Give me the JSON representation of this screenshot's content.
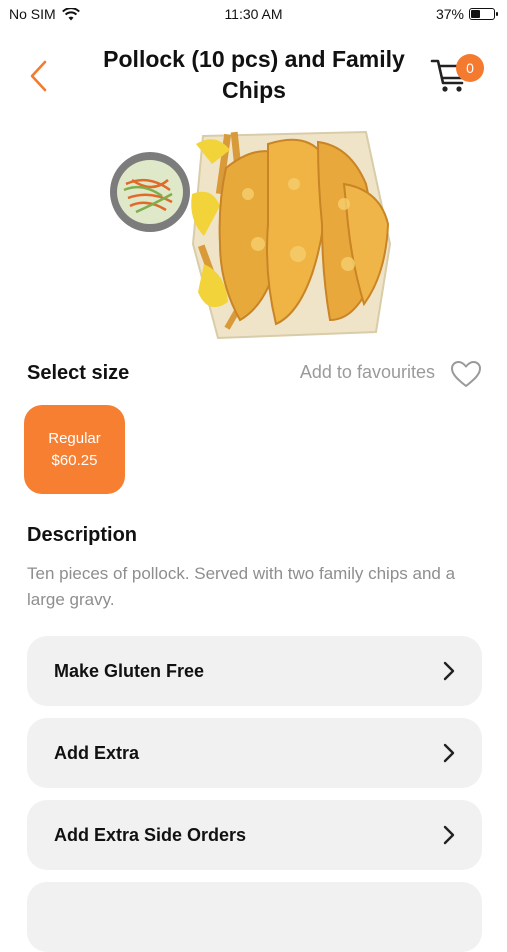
{
  "status_bar": {
    "carrier": "No SIM",
    "time": "11:30 AM",
    "battery": "37%",
    "battery_level": 0.37
  },
  "header": {
    "title": "Pollock (10 pcs) and Family Chips",
    "cart_count": "0"
  },
  "size_section": {
    "heading": "Select size",
    "favourites_label": "Add to favourites",
    "options": [
      {
        "name": "Regular",
        "price": "$60.25",
        "selected": true
      }
    ]
  },
  "description": {
    "heading": "Description",
    "text": "Ten pieces of pollock. Served with two family chips and a large gravy."
  },
  "options_list": [
    {
      "label": "Make Gluten Free"
    },
    {
      "label": "Add Extra"
    },
    {
      "label": "Add Extra Side Orders"
    },
    {
      "label": ""
    }
  ],
  "colors": {
    "accent": "#f77f32",
    "card_bg": "#f1f1f1",
    "muted_text": "#8e8e8e"
  },
  "icons": [
    "back-chevron-icon",
    "cart-icon",
    "heart-icon",
    "chevron-right-icon",
    "wifi-icon",
    "battery-icon"
  ]
}
